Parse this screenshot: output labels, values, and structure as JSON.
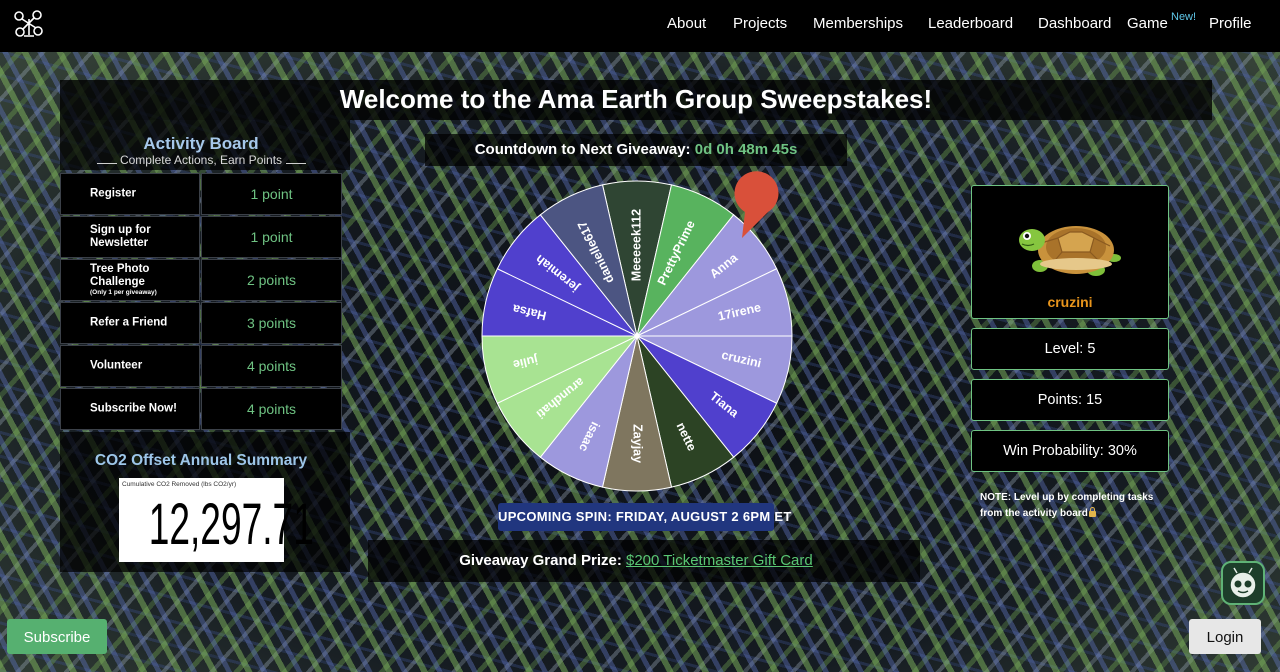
{
  "nav": {
    "items": [
      {
        "label": "About"
      },
      {
        "label": "Projects"
      },
      {
        "label": "Memberships"
      },
      {
        "label": "Leaderboard"
      },
      {
        "label": "Dashboard"
      },
      {
        "label": "Game"
      },
      {
        "label": "Profile"
      }
    ],
    "game_badge": "New!",
    "logo_icon": "drone-logo-icon"
  },
  "hero": {
    "title": "Welcome to the Ama Earth Group Sweepstakes!"
  },
  "countdown": {
    "label": "Countdown to Next Giveaway:",
    "value": "0d 0h 48m 45s"
  },
  "activity_board": {
    "title": "Activity Board",
    "subtitle": "Complete Actions, Earn Points",
    "rows": [
      {
        "task": "Register",
        "note": "",
        "points": "1 point"
      },
      {
        "task": "Sign up for Newsletter",
        "note": "",
        "points": "1 point"
      },
      {
        "task": "Tree Photo Challenge",
        "note": "(Only 1 per giveaway)",
        "points": "2 points"
      },
      {
        "task": "Refer a Friend",
        "note": "",
        "points": "3 points"
      },
      {
        "task": "Volunteer",
        "note": "",
        "points": "4 points"
      },
      {
        "task": "Subscribe Now!",
        "note": "",
        "points": "4 points"
      }
    ]
  },
  "co2": {
    "title": "CO2 Offset Annual Summary",
    "label": "Cumulative CO2 Removed (lbs CO2/yr)",
    "value": "12,297.71"
  },
  "wheel": {
    "segments": [
      {
        "name": "Meeeeek112",
        "color": "#2f4533"
      },
      {
        "name": "PrettyPrime",
        "color": "#58b35e"
      },
      {
        "name": "Anna",
        "color": "#9d98dd"
      },
      {
        "name": "17irene",
        "color": "#9d98dd"
      },
      {
        "name": "cruzini",
        "color": "#9d98dd"
      },
      {
        "name": "Tiana",
        "color": "#5040cd"
      },
      {
        "name": "nette",
        "color": "#2c4324"
      },
      {
        "name": "Zayjay",
        "color": "#7f765f"
      },
      {
        "name": "isaac",
        "color": "#9d98dd"
      },
      {
        "name": "arundhati",
        "color": "#a8e392"
      },
      {
        "name": "julie",
        "color": "#a8e392"
      },
      {
        "name": "Hafsa",
        "color": "#5040cd"
      },
      {
        "name": "jeremiah",
        "color": "#5040cd"
      },
      {
        "name": "danielle617",
        "color": "#4c5582"
      }
    ],
    "pointer_color": "#d9503a"
  },
  "upcoming_spin": "UPCOMING SPIN: FRIDAY, AUGUST 2 6PM ET",
  "prize": {
    "label": "Giveaway Grand Prize:",
    "link": "$200 Ticketmaster Gift Card"
  },
  "profile": {
    "avatar_icon": "turtle-icon",
    "username": "cruzini",
    "level": "Level: 5",
    "points": "Points: 15",
    "win_probability": "Win Probability: 30%",
    "note": "NOTE: Level up by completing tasks from the activity board"
  },
  "buttons": {
    "subscribe": "Subscribe",
    "login": "Login",
    "assistant_icon": "robot-assistant-icon"
  }
}
